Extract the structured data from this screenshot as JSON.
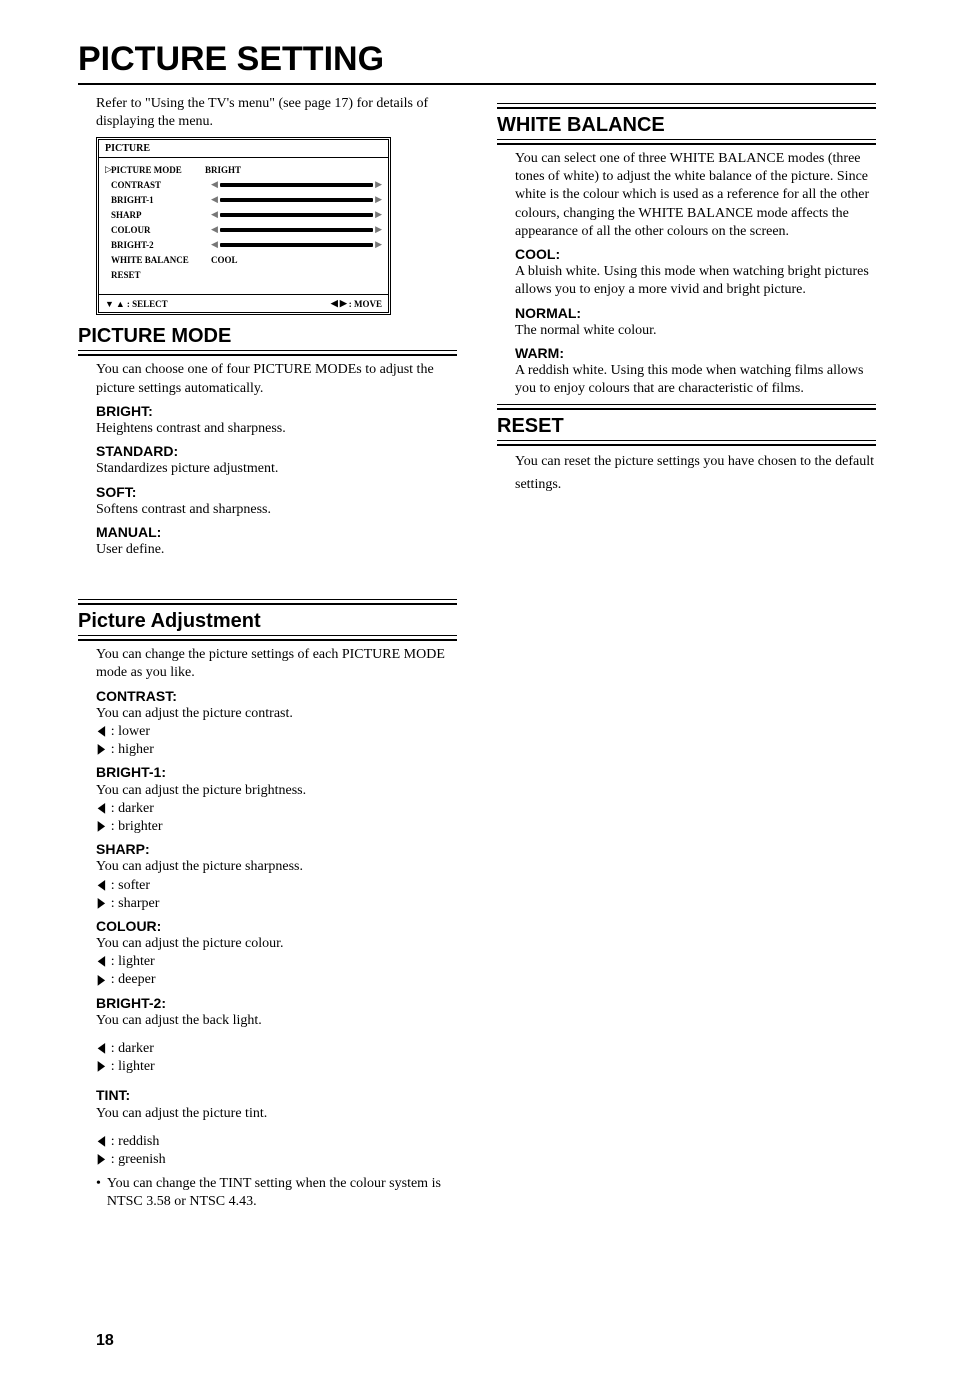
{
  "page_title": "PICTURE SETTING",
  "intro": "Refer to \"Using the TV's menu\" (see page 17) for details of displaying the menu.",
  "menu": {
    "title": "PICTURE",
    "rows": [
      {
        "label": "PICTURE   MODE",
        "value": "BRIGHT",
        "pointer": true
      },
      {
        "label": "CONTRAST",
        "slider": true
      },
      {
        "label": "BRIGHT-1",
        "slider": true
      },
      {
        "label": "SHARP",
        "slider": true
      },
      {
        "label": "COLOUR",
        "slider": true
      },
      {
        "label": "BRIGHT-2",
        "slider": true
      },
      {
        "label": "WHITE BALANCE",
        "value": "COOL"
      },
      {
        "label": "RESET"
      }
    ],
    "footer_left": ": SELECT",
    "footer_right": ": MOVE"
  },
  "picture_mode": {
    "heading": "PICTURE MODE",
    "intro": "You can choose one of four PICTURE MODEs to adjust the picture settings automatically.",
    "items": [
      {
        "h": "BRIGHT:",
        "t": "Heightens contrast and sharpness."
      },
      {
        "h": "STANDARD:",
        "t": "Standardizes picture adjustment."
      },
      {
        "h": "SOFT:",
        "t": "Softens contrast and sharpness."
      },
      {
        "h": "MANUAL:",
        "t": "User define."
      }
    ]
  },
  "adjustment": {
    "heading": "Picture Adjustment",
    "intro": "You can change the picture settings of each PICTURE MODE mode as you like.",
    "items": [
      {
        "h": "CONTRAST:",
        "t": "You can adjust the picture contrast.",
        "left": "lower",
        "right": "higher"
      },
      {
        "h": "BRIGHT-1:",
        "t": "You can adjust the picture brightness.",
        "left": "darker",
        "right": "brighter"
      },
      {
        "h": "SHARP:",
        "t": "You can adjust the picture sharpness.",
        "left": "softer",
        "right": "sharper"
      },
      {
        "h": "COLOUR:",
        "t": "You can adjust the picture colour.",
        "left": "lighter",
        "right": "deeper"
      },
      {
        "h": "BRIGHT-2:",
        "t": "You can adjust the back light.",
        "left": "darker",
        "right": "lighter",
        "gap": true
      },
      {
        "h": "TINT:",
        "t": "You can adjust the picture tint.",
        "left": "reddish",
        "right": "greenish",
        "gap": true
      }
    ],
    "note": "You can change the TINT setting when the colour system is NTSC 3.58 or NTSC 4.43."
  },
  "white_balance": {
    "heading": "WHITE  BALANCE",
    "intro": "You can select one of three WHITE BALANCE modes (three tones of white) to adjust the white balance of the picture. Since white is the colour which is used as a reference for all the other colours, changing the WHITE BALANCE mode affects the appearance of all the other colours on the screen.",
    "items": [
      {
        "h": "COOL:",
        "t": "A bluish white. Using this mode when watching bright pictures allows you to enjoy a more vivid and bright picture."
      },
      {
        "h": "NORMAL:",
        "t": "The normal white colour."
      },
      {
        "h": "WARM:",
        "t": "A reddish white. Using this mode when watching films allows you to enjoy colours that are characteristic of films."
      }
    ]
  },
  "reset": {
    "heading": "RESET",
    "text": "You can reset the picture settings you have chosen to the default settings."
  },
  "page_number": "18"
}
